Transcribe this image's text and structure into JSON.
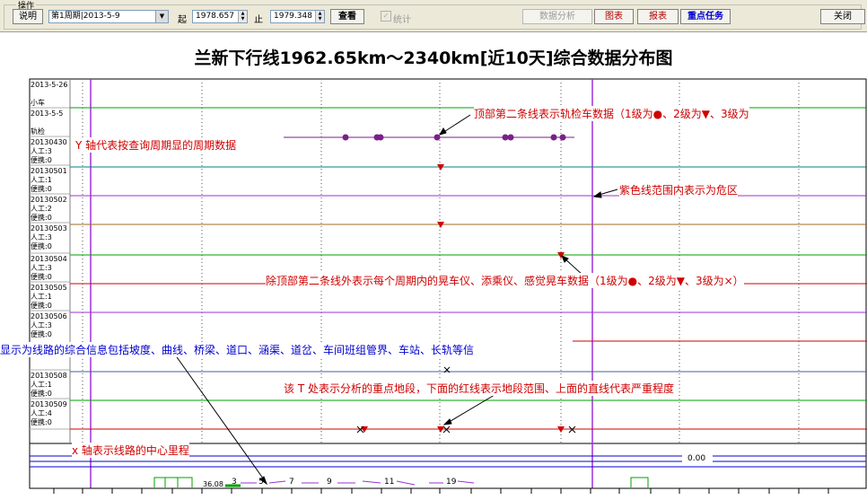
{
  "toolbar": {
    "group_label": "操作",
    "explain_btn": "说明",
    "period_select": "第1周期|2013-5-9",
    "from_label": "起",
    "from_value": "1978.657",
    "to_label": "止",
    "to_value": "1979.348",
    "query_btn": "查看",
    "stat_label": "统计",
    "data_analysis_btn": "数据分析",
    "chart_btn": "图表",
    "report_btn": "报表",
    "key_task_btn": "重点任务",
    "close_btn": "关闭"
  },
  "chart": {
    "title": "兰新下行线1962.65km～2340km[近10天]综合数据分布图",
    "rows": [
      {
        "date": "2013-5-26",
        "type": "小车"
      },
      {
        "date": "2013-5-5",
        "type": "轨检"
      },
      {
        "date": "20130430",
        "manual": "人工:3",
        "portable": "便携:0"
      },
      {
        "date": "20130501",
        "manual": "人工:1",
        "portable": "便携:0"
      },
      {
        "date": "20130502",
        "manual": "人工:2",
        "portable": "便携:0"
      },
      {
        "date": "20130503",
        "manual": "人工:3",
        "portable": "便携:0"
      },
      {
        "date": "20130504",
        "manual": "人工:3",
        "portable": "便携:0"
      },
      {
        "date": "20130505",
        "manual": "人工:1",
        "portable": "便携:0"
      },
      {
        "date": "20130506",
        "manual": "人工:3",
        "portable": "便携:0"
      },
      {
        "date": "20130508",
        "manual": "人工:1",
        "portable": "便携:0"
      },
      {
        "date": "20130509",
        "manual": "人工:4",
        "portable": "便携:0"
      }
    ],
    "value_label": "0.00",
    "km_start": "36.08",
    "km_ticks": [
      "3",
      "5",
      "7",
      "9",
      "11",
      "19"
    ]
  },
  "annotations": {
    "top_line": "顶部第二条线表示轨检车数据（1级为●、2级为▼、3级为",
    "y_axis": "Y 轴代表按查询周期显的周期数据",
    "purple": "紫色线范围内表示为危区",
    "other_lines": "除顶部第二条线外表示每个周期内的晃车仪、添乘仪、感觉晃车数据（1级为●、2级为▼、3级为×）",
    "bottom_info": "显示为线路的综合信息包括坡度、曲线、桥梁、道口、涵渠、道岔、车间班组管界、车站、长轨等信",
    "key_section": "该 T 处表示分析的重点地段，下面的红线表示地段范围、上面的直线代表严重程度",
    "x_axis": "x 轴表示线路的中心里程"
  },
  "colors": {
    "red": "#d00000",
    "purple": "#9b30d9",
    "green": "#00a000",
    "teal": "#008080",
    "blue": "#0000d0"
  }
}
